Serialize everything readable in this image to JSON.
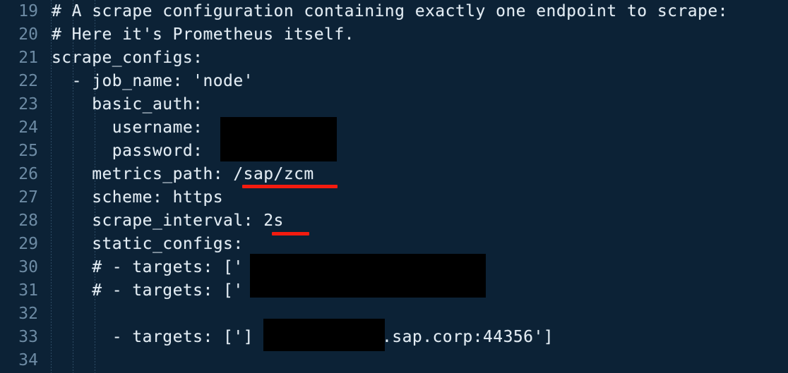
{
  "editor": {
    "background_color": "#0c2236",
    "text_color": "#e3ecf3",
    "line_number_color": "#6d8ba4",
    "indent_guide_color": "#2c4a63",
    "redaction_color": "#000000",
    "annotation_color": "#f41b0f",
    "language": "yaml",
    "first_visible_line": 19,
    "last_visible_line": 34
  },
  "lines": [
    {
      "number": "19",
      "text": "# A scrape configuration containing exactly one endpoint to scrape:"
    },
    {
      "number": "20",
      "text": "# Here it's Prometheus itself."
    },
    {
      "number": "21",
      "text": "scrape_configs:"
    },
    {
      "number": "22",
      "text": "  - job_name: 'node'"
    },
    {
      "number": "23",
      "text": "    basic_auth:"
    },
    {
      "number": "24",
      "text": "      username:"
    },
    {
      "number": "25",
      "text": "      password:"
    },
    {
      "number": "26",
      "text": "    metrics_path: /sap/zcm"
    },
    {
      "number": "27",
      "text": "    scheme: https"
    },
    {
      "number": "28",
      "text": "    scrape_interval: 2s"
    },
    {
      "number": "29",
      "text": "    static_configs:"
    },
    {
      "number": "30",
      "text": "    # - targets: ['"
    },
    {
      "number": "31",
      "text": "    # - targets: ['"
    },
    {
      "number": "32",
      "text": ""
    },
    {
      "number": "33",
      "text": "      - targets: [']"
    },
    {
      "number": "34",
      "text": ""
    }
  ],
  "line33_suffix": ".sap.corp:44356']",
  "redactions": [
    {
      "name": "credentials-redaction",
      "covers": "username and password values"
    },
    {
      "name": "targets-redaction",
      "covers": "commented target hostnames on lines 30 and 31"
    },
    {
      "name": "hostname-redaction",
      "covers": "hostname portion of target on line 33"
    }
  ],
  "annotations": [
    {
      "name": "metrics-path-underline",
      "marks": "/sap/zcm"
    },
    {
      "name": "scrape-interval-underline",
      "marks": "2s"
    }
  ]
}
